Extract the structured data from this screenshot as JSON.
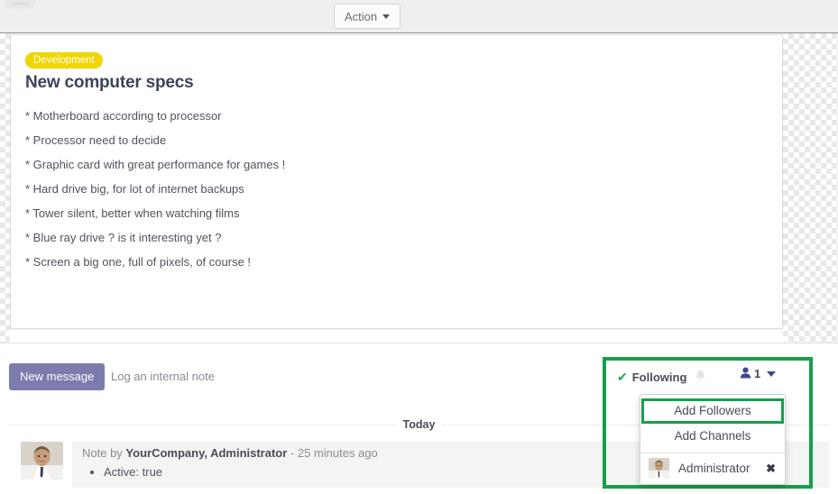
{
  "topbar": {
    "action_button_label": "Action",
    "caret_icon": "caret-down-icon",
    "breadcrumb_icon": "breadcrumb-pill"
  },
  "record": {
    "tag": "Development",
    "title": "New computer specs",
    "description_lines": [
      "* Motherboard according to processor",
      "* Processor need to decide",
      "* Graphic card with great performance for games !",
      "* Hard drive big, for lot of internet backups",
      "* Tower silent, better when watching films",
      "* Blue ray drive ? is it interesting yet ?",
      "* Screen a big one, full of pixels, of course !"
    ]
  },
  "chatter": {
    "new_message_label": "New message",
    "log_note_label": "Log an internal note",
    "date_separator": "Today",
    "message": {
      "prefix": "Note by ",
      "author": "YourCompany, Administrator",
      "timestamp": " - 25 minutes ago",
      "avatar_icon": "user-avatar",
      "body_items": [
        "Active: true"
      ]
    }
  },
  "followers": {
    "check_icon": "check-icon",
    "following_label": "Following",
    "bell_icon": "bell-icon",
    "user_icon": "user-icon",
    "count": "1",
    "caret_icon": "caret-down-icon",
    "dropdown": {
      "add_followers_label": "Add Followers",
      "add_channels_label": "Add Channels",
      "entries": [
        {
          "name": "Administrator",
          "avatar_icon": "user-avatar",
          "remove_icon": "remove-icon",
          "remove_glyph": "✖"
        }
      ]
    }
  },
  "colors": {
    "tag_yellow": "#f0d500",
    "primary_purple": "#7c7bad",
    "highlight_green": "#15a04a",
    "check_green": "#25a35a",
    "topbar_gray": "#efefef"
  },
  "glyphs": {
    "check": "✔",
    "bell": "🔔",
    "user": "👤"
  }
}
